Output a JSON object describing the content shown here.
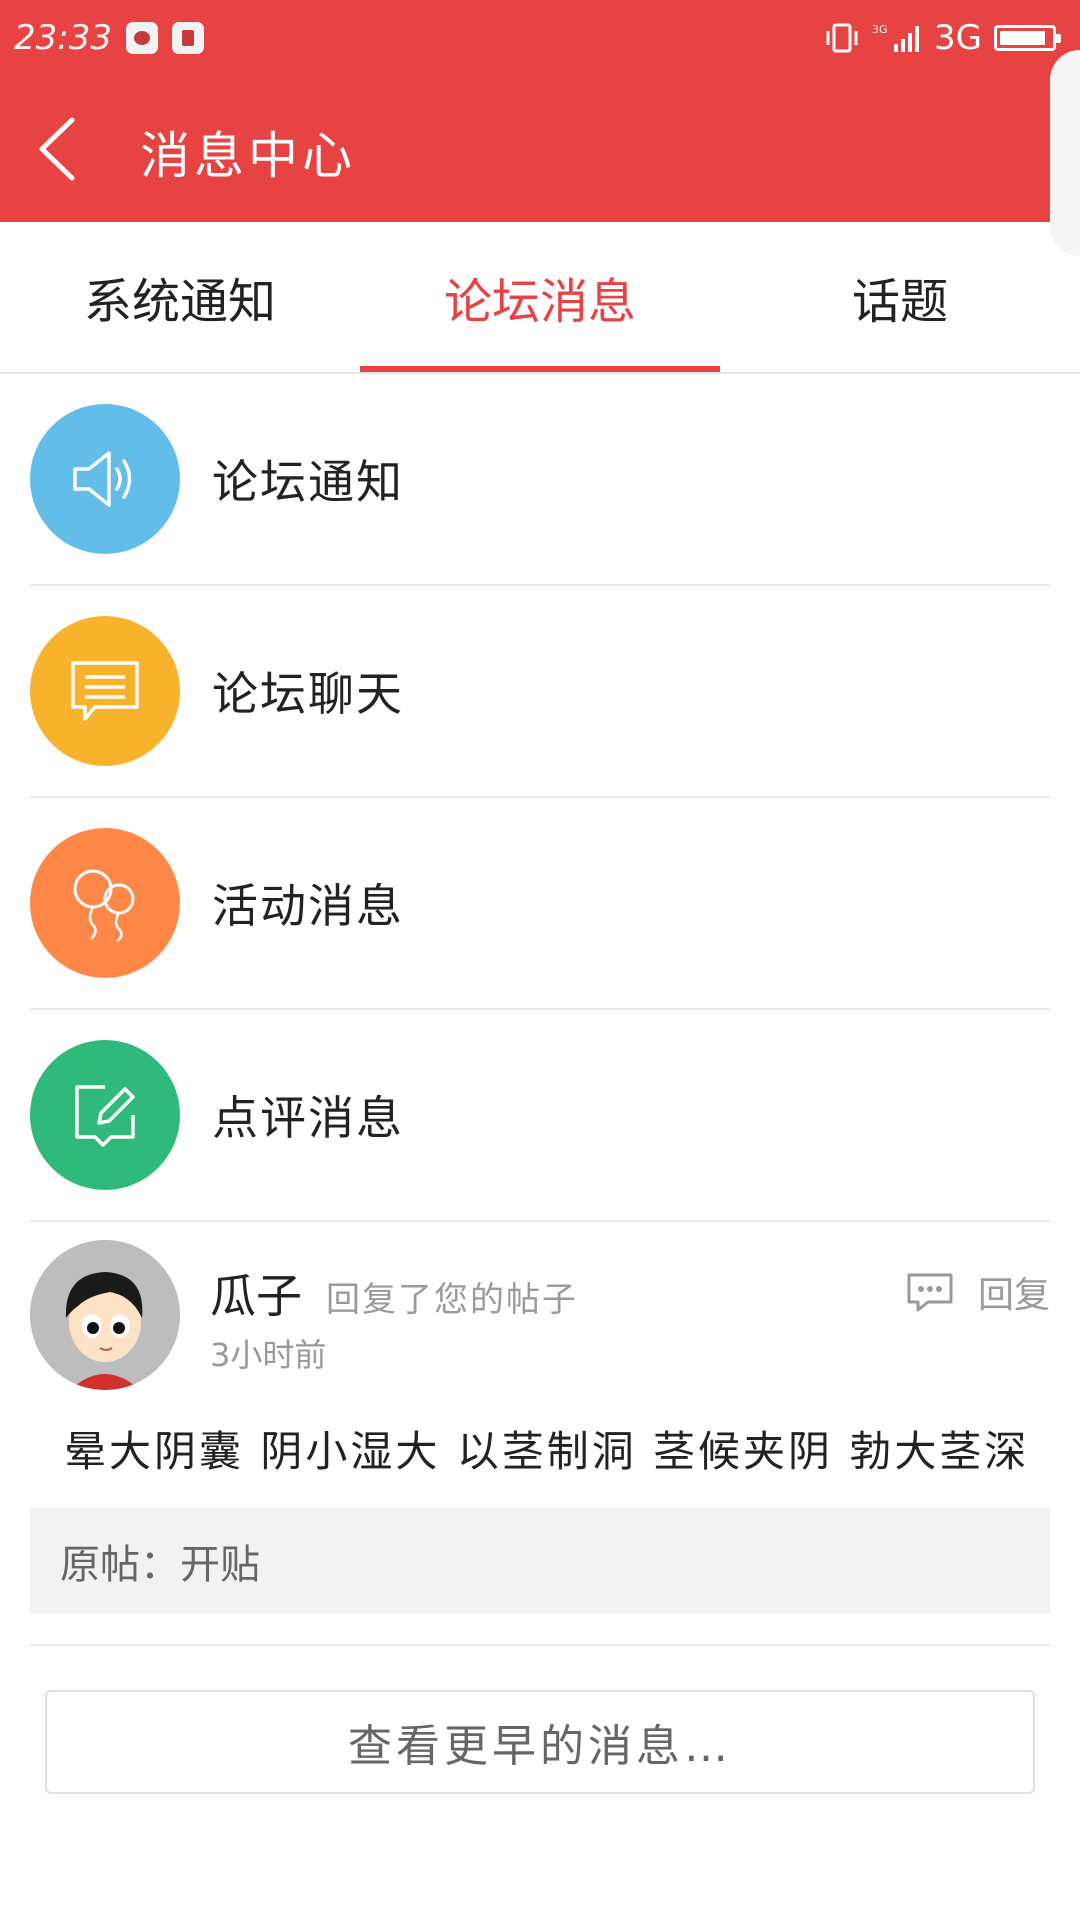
{
  "status_bar": {
    "time": "23:33",
    "network": "3G",
    "battery_level": 0.9
  },
  "header": {
    "title": "消息中心"
  },
  "tabs": [
    {
      "label": "系统通知"
    },
    {
      "label": "论坛消息",
      "active": true
    },
    {
      "label": "话题"
    }
  ],
  "categories": [
    {
      "label": "论坛通知",
      "icon": "speaker-icon",
      "color": "#62bde8"
    },
    {
      "label": "论坛聊天",
      "icon": "chat-bubble-icon",
      "color": "#f8b22c"
    },
    {
      "label": "活动消息",
      "icon": "balloons-icon",
      "color": "#ff8849"
    },
    {
      "label": "点评消息",
      "icon": "edit-icon",
      "color": "#2fb97a"
    }
  ],
  "message": {
    "user": "瓜子",
    "action": "回复了您的帖子",
    "time": "3小时前",
    "reply_label": "回复",
    "content": "晕大阴囊 阴小湿大 以茎制洞 茎候夹阴 勃大茎深",
    "original": "原帖：开贴"
  },
  "load_more": "查看更早的消息…"
}
